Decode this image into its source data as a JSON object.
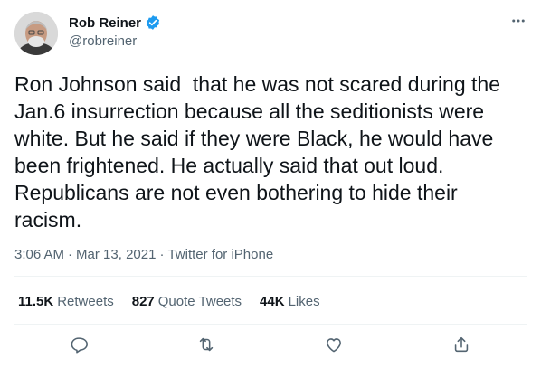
{
  "author": {
    "display_name": "Rob Reiner",
    "handle": "@robreiner",
    "verified": true
  },
  "tweet": {
    "text": "Ron Johnson said  that he was not scared during the Jan.6 insurrection because all the seditionists were white. But he said if they were Black, he would have been frightened. He actually said that out loud. Republicans are not even bothering to hide their racism.",
    "time": "3:06 AM",
    "separator": "·",
    "date": "Mar 13, 2021",
    "source": "Twitter for iPhone"
  },
  "stats": {
    "retweets_count": "11.5K",
    "retweets_label": "Retweets",
    "quote_tweets_count": "827",
    "quote_tweets_label": "Quote Tweets",
    "likes_count": "44K",
    "likes_label": "Likes"
  },
  "icons": {
    "more": "more-icon",
    "reply": "reply-icon",
    "retweet": "retweet-icon",
    "like": "like-icon",
    "share": "share-icon",
    "verified": "verified-badge-icon"
  },
  "colors": {
    "verified_blue": "#1d9bf0",
    "secondary_text": "#536471",
    "primary_text": "#0f1419"
  }
}
